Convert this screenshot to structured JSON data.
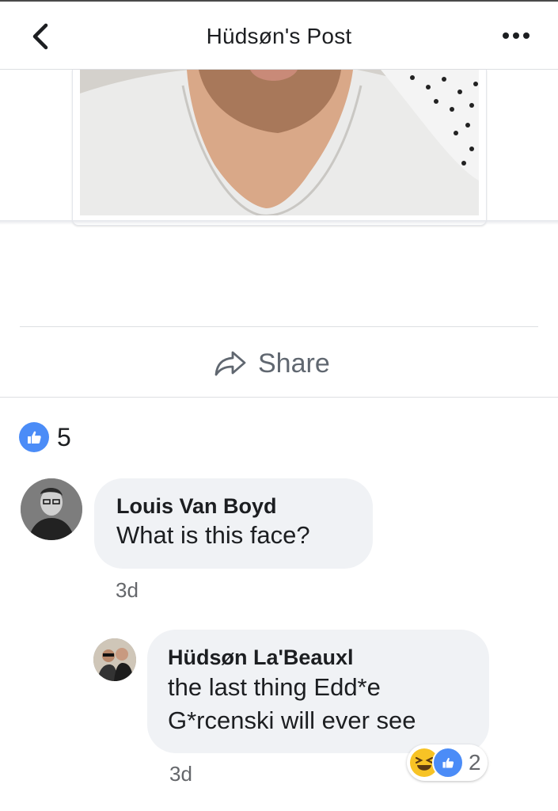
{
  "header": {
    "title": "Hüdsøn's Post",
    "back_icon": "chevron-left-icon",
    "more_icon": "more-horizontal-icon"
  },
  "actions": {
    "share_label": "Share",
    "share_icon": "share-arrow-icon"
  },
  "likes": {
    "count": "5",
    "icon": "like-thumb-icon",
    "color": "#4b8cf7"
  },
  "comments": [
    {
      "author": "Louis Van Boyd",
      "text": "What is this face?",
      "time": "3d"
    }
  ],
  "reply": {
    "author": "Hüdsøn La'Beauxl",
    "text_line1": "the last thing Edd*e",
    "text_line2": "G*rcenski will ever see",
    "time": "3d",
    "reactions": {
      "count": "2",
      "icons": [
        "haha-emoji-icon",
        "like-thumb-icon"
      ]
    }
  }
}
